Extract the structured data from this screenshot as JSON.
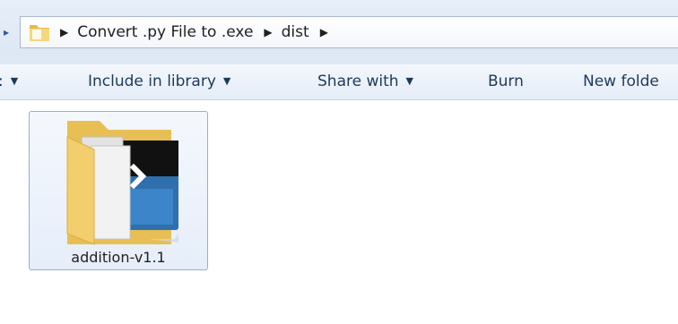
{
  "address_bar": {
    "breadcrumbs": [
      "Convert .py File to .exe",
      "dist"
    ],
    "folder_icon": "folder-icon",
    "separator_icon": "triangle-right-icon"
  },
  "toolbar": {
    "partial_caret_icon": "chevron-down-icon",
    "include_label": "Include in library",
    "share_label": "Share with",
    "burn_label": "Burn",
    "new_folder_label": "New folde"
  },
  "files": [
    {
      "name": "addition-v1.1",
      "icon": "executable-folder-icon",
      "selected": true
    }
  ],
  "colors": {
    "toolbar_text": "#1e395b",
    "selection_border": "#8fb0d9",
    "folder_yellow": "#f2cf6c"
  }
}
